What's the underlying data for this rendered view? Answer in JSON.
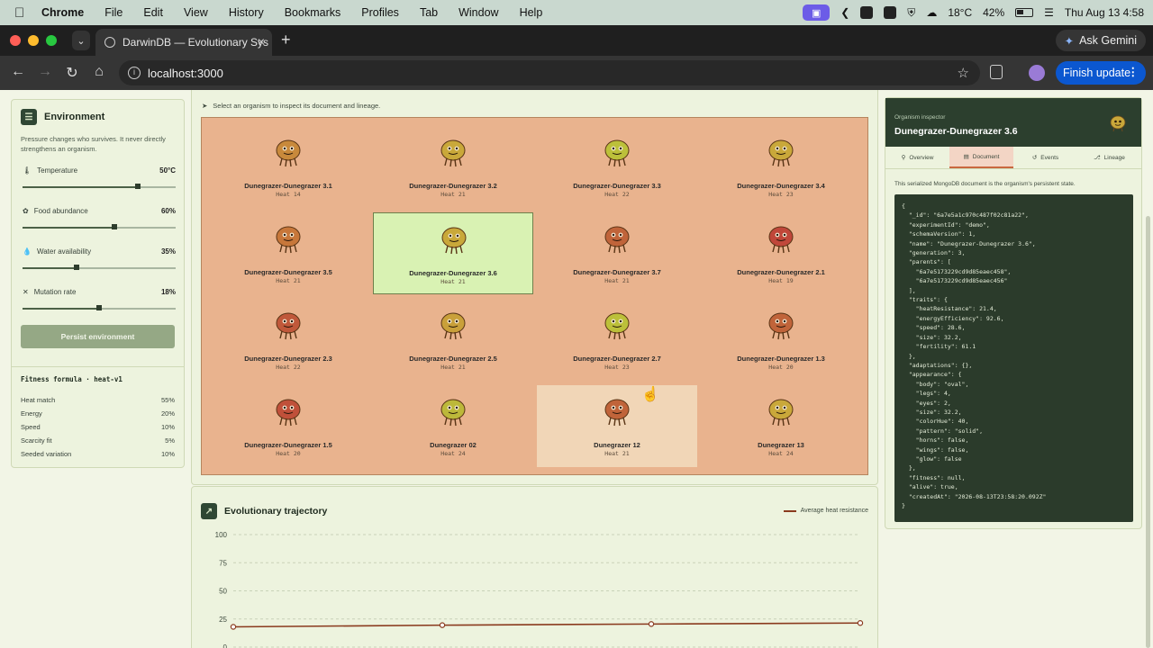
{
  "menubar": {
    "app": "Chrome",
    "items": [
      "File",
      "Edit",
      "View",
      "History",
      "Bookmarks",
      "Profiles",
      "Tab",
      "Window",
      "Help"
    ],
    "weather": "18°C",
    "battery": "42%",
    "datetime": "Thu Aug 13  4:58"
  },
  "browser": {
    "tab_title": "DarwinDB — Evolutionary Sys",
    "url": "localhost:3000",
    "ask_gemini": "Ask Gemini",
    "finish_update": "Finish update"
  },
  "environment": {
    "title": "Environment",
    "description": "Pressure changes who survives. It never directly strengthens an organism.",
    "sliders": [
      {
        "label": "Temperature",
        "value": "50°C",
        "level": 0.75,
        "icon": "thermometer-icon"
      },
      {
        "label": "Food abundance",
        "value": "60%",
        "level": 0.6,
        "icon": "leaf-icon"
      },
      {
        "label": "Water availability",
        "value": "35%",
        "level": 0.35,
        "icon": "droplet-icon"
      },
      {
        "label": "Mutation rate",
        "value": "18%",
        "level": 0.5,
        "icon": "dna-icon"
      }
    ],
    "persist_button": "Persist environment",
    "fitness_formula_title": "Fitness formula · heat-v1",
    "fitness_rows": [
      {
        "label": "Heat match",
        "value": "55%"
      },
      {
        "label": "Energy",
        "value": "20%"
      },
      {
        "label": "Speed",
        "value": "10%"
      },
      {
        "label": "Scarcity fit",
        "value": "5%"
      },
      {
        "label": "Seeded variation",
        "value": "10%"
      }
    ]
  },
  "population": {
    "hint": "Select an organism to inspect its document and lineage.",
    "organisms": [
      {
        "name": "Dunegrazer-Dunegrazer 3.1",
        "heat": "Heat 14",
        "color": "#c8893b"
      },
      {
        "name": "Dunegrazer-Dunegrazer 3.2",
        "heat": "Heat 21",
        "color": "#c9a83a"
      },
      {
        "name": "Dunegrazer-Dunegrazer 3.3",
        "heat": "Heat 22",
        "color": "#bcc03a"
      },
      {
        "name": "Dunegrazer-Dunegrazer 3.4",
        "heat": "Heat 23",
        "color": "#c9a83a"
      },
      {
        "name": "Dunegrazer-Dunegrazer 3.5",
        "heat": "Heat 21",
        "color": "#c7773a"
      },
      {
        "name": "Dunegrazer-Dunegrazer 3.6",
        "heat": "Heat 21",
        "color": "#c9a83a",
        "selected": true
      },
      {
        "name": "Dunegrazer-Dunegrazer 3.7",
        "heat": "Heat 21",
        "color": "#c0643a"
      },
      {
        "name": "Dunegrazer-Dunegrazer 2.1",
        "heat": "Heat 19",
        "color": "#c0473a"
      },
      {
        "name": "Dunegrazer-Dunegrazer 2.3",
        "heat": "Heat 22",
        "color": "#c0583a"
      },
      {
        "name": "Dunegrazer-Dunegrazer 2.5",
        "heat": "Heat 21",
        "color": "#c9a03a"
      },
      {
        "name": "Dunegrazer-Dunegrazer 2.7",
        "heat": "Heat 23",
        "color": "#bcc03a"
      },
      {
        "name": "Dunegrazer-Dunegrazer 1.3",
        "heat": "Heat 20",
        "color": "#c0643a"
      },
      {
        "name": "Dunegrazer-Dunegrazer 1.5",
        "heat": "Heat 20",
        "color": "#c0503a"
      },
      {
        "name": "Dunegrazer 02",
        "heat": "Heat 24",
        "color": "#bcb83a"
      },
      {
        "name": "Dunegrazer 12",
        "heat": "Heat 21",
        "color": "#c0643a",
        "highlighted": true
      },
      {
        "name": "Dunegrazer 13",
        "heat": "Heat 24",
        "color": "#c9a83a"
      }
    ]
  },
  "trajectory": {
    "title": "Evolutionary trajectory",
    "chart_data": {
      "type": "line",
      "series": [
        {
          "name": "Average heat resistance",
          "values": [
            18,
            19.5,
            20.5,
            21.4
          ]
        }
      ],
      "yticks": [
        "100",
        "75",
        "50",
        "25",
        "0"
      ],
      "ylim": [
        0,
        100
      ],
      "grid": true,
      "legend": "top-right",
      "line_color": "#8a3a1e"
    }
  },
  "inspector": {
    "kicker": "Organism inspector",
    "title": "Dunegrazer-Dunegrazer 3.6",
    "tabs": [
      {
        "label": "Overview",
        "icon": "pin-icon"
      },
      {
        "label": "Document",
        "icon": "document-icon",
        "active": true
      },
      {
        "label": "Events",
        "icon": "history-icon"
      },
      {
        "label": "Lineage",
        "icon": "tree-icon"
      }
    ],
    "note": "This serialized MongoDB document is the organism's persistent state.",
    "document": "{\n  \"_id\": \"6a7e5a1c970c487f02c81a22\",\n  \"experimentId\": \"demo\",\n  \"schemaVersion\": 1,\n  \"name\": \"Dunegrazer-Dunegrazer 3.6\",\n  \"generation\": 3,\n  \"parents\": [\n    \"6a7e5173229cd9d85eaec458\",\n    \"6a7e5173229cd9d85eaec456\"\n  ],\n  \"traits\": {\n    \"heatResistance\": 21.4,\n    \"energyEfficiency\": 92.6,\n    \"speed\": 28.6,\n    \"size\": 32.2,\n    \"fertility\": 61.1\n  },\n  \"adaptations\": {},\n  \"appearance\": {\n    \"body\": \"oval\",\n    \"legs\": 4,\n    \"eyes\": 2,\n    \"size\": 32.2,\n    \"colorHue\": 40,\n    \"pattern\": \"solid\",\n    \"horns\": false,\n    \"wings\": false,\n    \"glow\": false\n  },\n  \"fitness\": null,\n  \"alive\": true,\n  \"createdAt\": \"2026-08-13T23:58:20.092Z\"\n}"
  }
}
